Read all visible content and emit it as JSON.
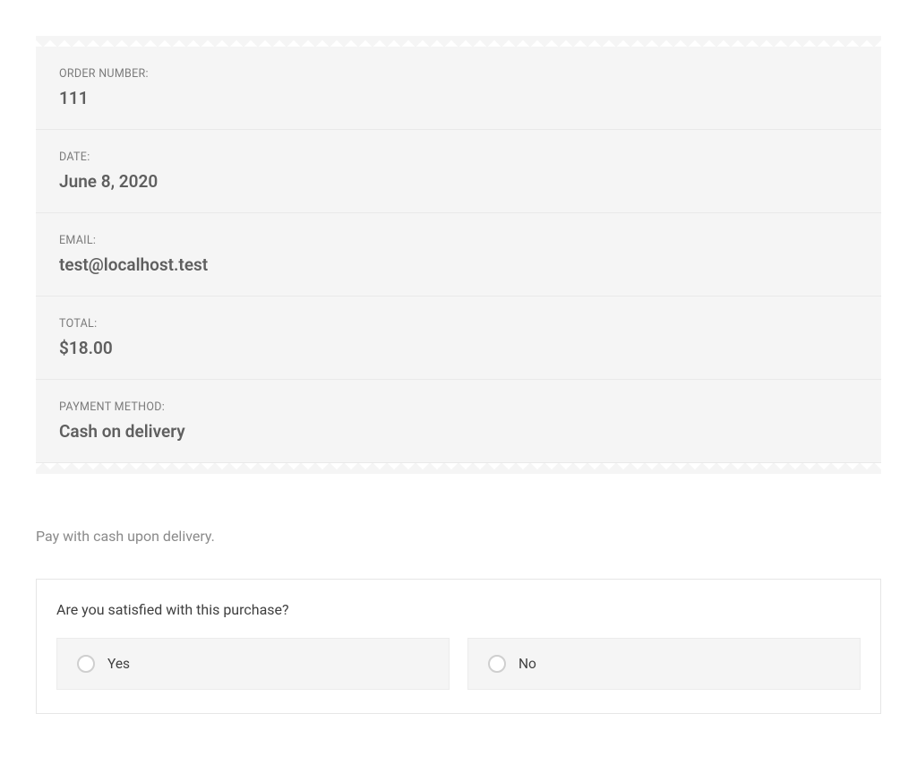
{
  "order": {
    "rows": [
      {
        "label": "ORDER NUMBER:",
        "value": "111"
      },
      {
        "label": "DATE:",
        "value": "June 8, 2020"
      },
      {
        "label": "EMAIL:",
        "value": "test@localhost.test"
      },
      {
        "label": "TOTAL:",
        "value": "$18.00"
      },
      {
        "label": "PAYMENT METHOD:",
        "value": "Cash on delivery"
      }
    ]
  },
  "payment_note": "Pay with cash upon delivery.",
  "survey": {
    "question": "Are you satisfied with this purchase?",
    "options": {
      "yes": "Yes",
      "no": "No"
    }
  }
}
